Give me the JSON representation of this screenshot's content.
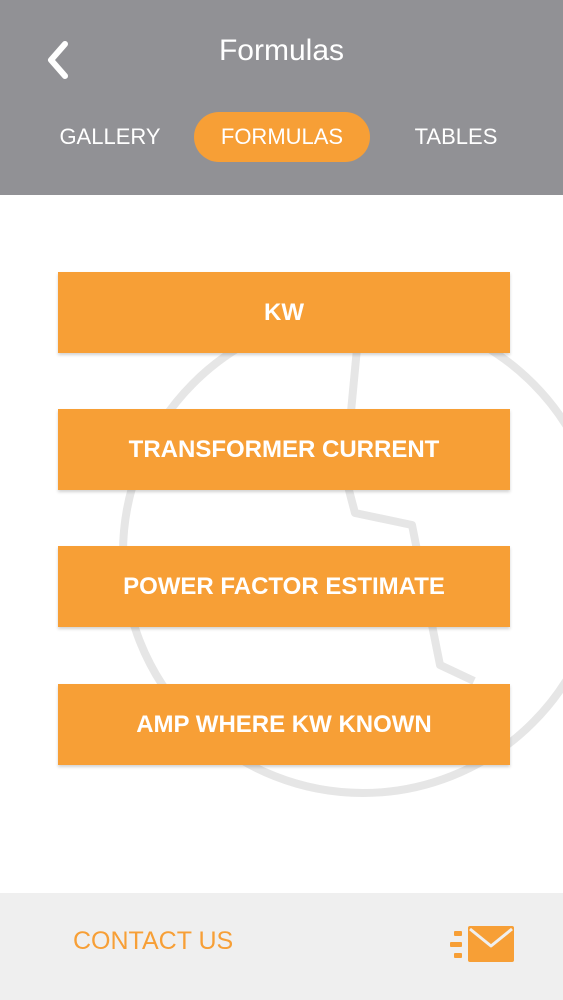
{
  "header": {
    "title": "Formulas",
    "back_icon": "chevron-left-icon",
    "tabs": [
      {
        "label": "GALLERY",
        "active": false
      },
      {
        "label": "FORMULAS",
        "active": true
      },
      {
        "label": "TABLES",
        "active": false
      }
    ]
  },
  "formulas": [
    {
      "label": "KW"
    },
    {
      "label": "TRANSFORMER CURRENT"
    },
    {
      "label": "POWER FACTOR ESTIMATE"
    },
    {
      "label": "AMP WHERE KW KNOWN"
    }
  ],
  "footer": {
    "contact_label": "CONTACT US",
    "mail_icon": "envelope-icon"
  },
  "colors": {
    "header_bg": "#919195",
    "accent": "#f79f36",
    "footer_bg": "#efefef",
    "watermark": "#e6e6e6"
  }
}
